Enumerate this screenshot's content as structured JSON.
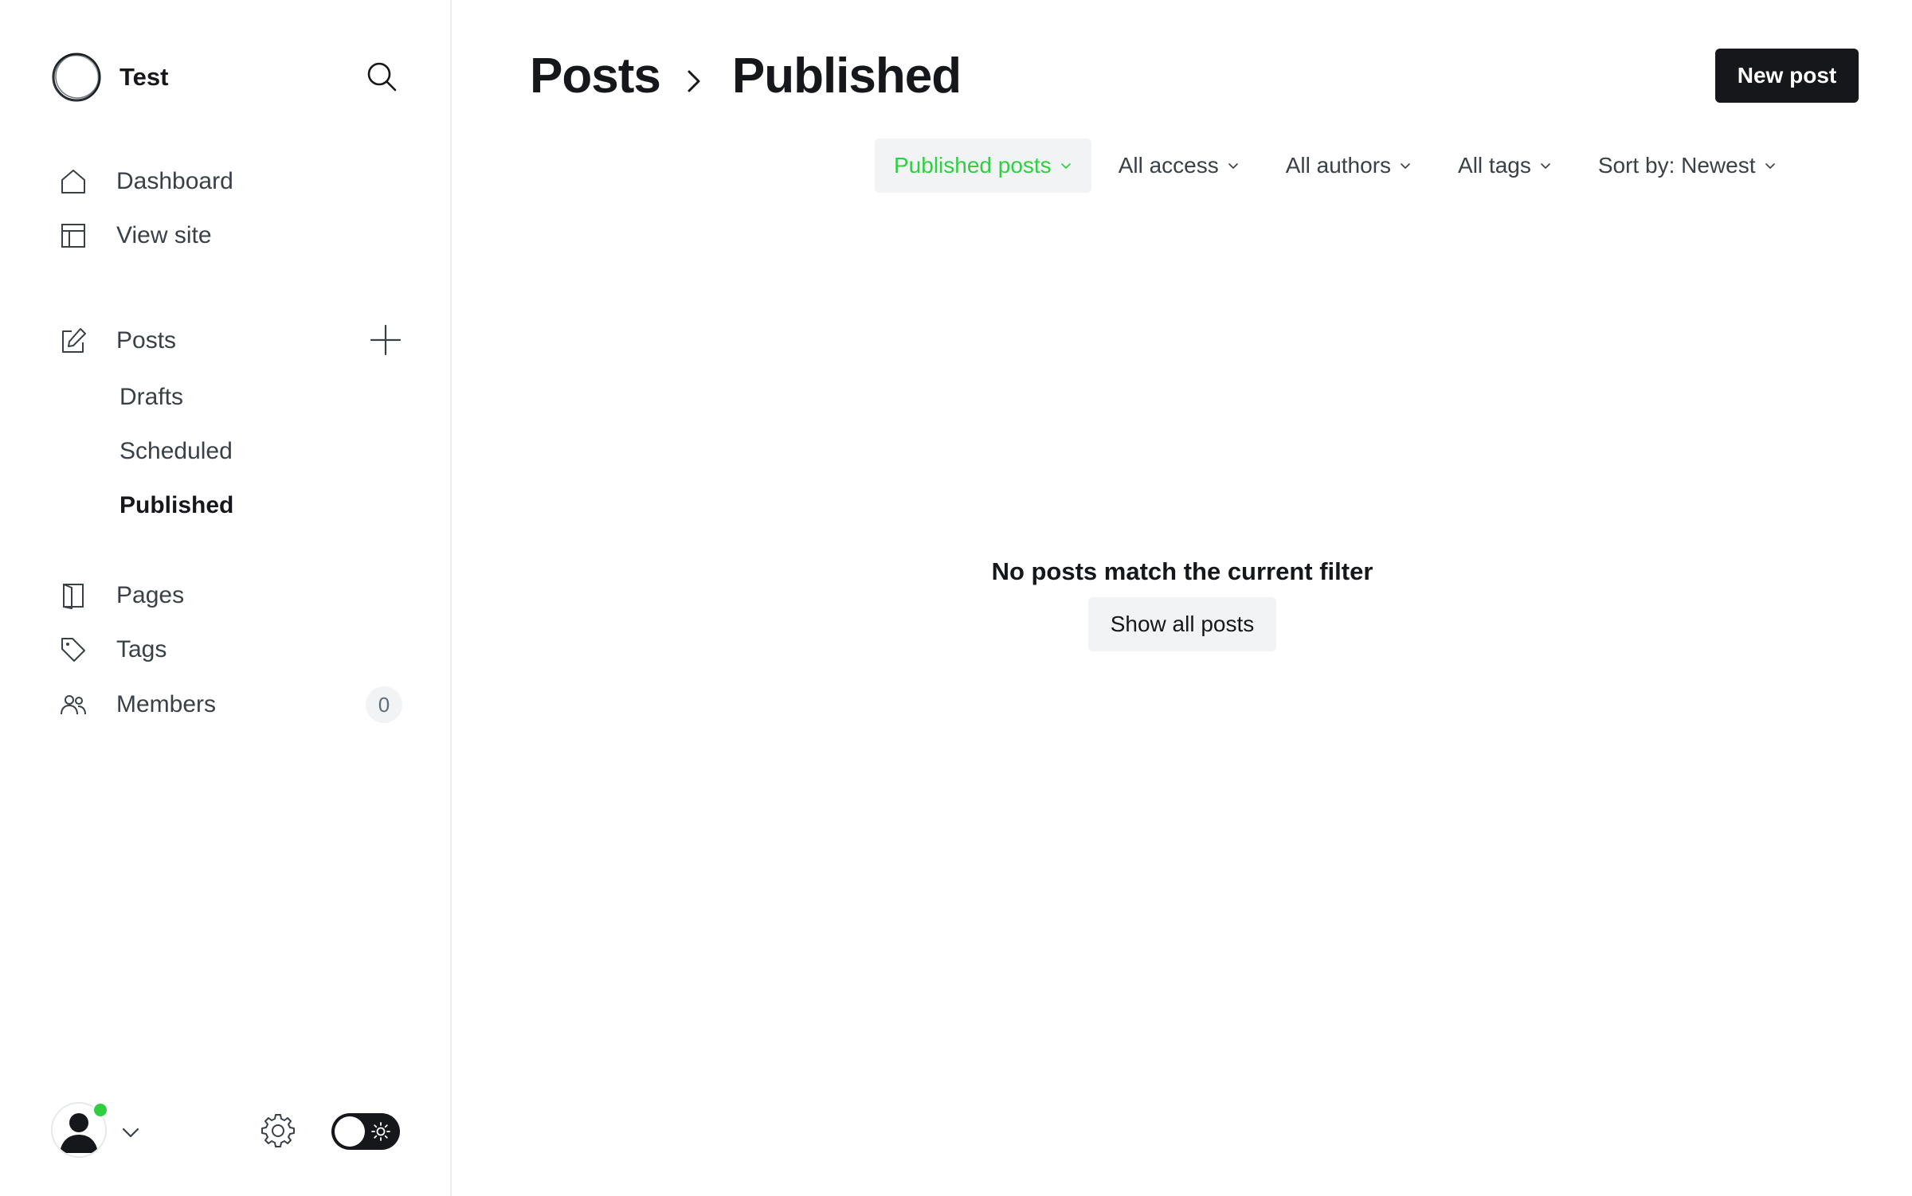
{
  "brand": {
    "name": "Test"
  },
  "sidebar": {
    "nav_top": [
      {
        "label": "Dashboard",
        "icon": "home-icon"
      },
      {
        "label": "View site",
        "icon": "layout-icon"
      }
    ],
    "posts": {
      "label": "Posts",
      "icon": "edit-icon",
      "add_icon": "plus-icon",
      "sub_items": [
        {
          "label": "Drafts",
          "active": false
        },
        {
          "label": "Scheduled",
          "active": false
        },
        {
          "label": "Published",
          "active": true
        }
      ]
    },
    "nav_bottom": [
      {
        "label": "Pages",
        "icon": "pages-icon"
      },
      {
        "label": "Tags",
        "icon": "tag-icon"
      },
      {
        "label": "Members",
        "icon": "members-icon",
        "count": "0"
      }
    ],
    "footer": {
      "online": true,
      "theme": "light"
    }
  },
  "header": {
    "breadcrumb_root": "Posts",
    "breadcrumb_current": "Published",
    "new_post_label": "New post"
  },
  "filters": [
    {
      "label": "Published posts",
      "active": true
    },
    {
      "label": "All access",
      "active": false
    },
    {
      "label": "All authors",
      "active": false
    },
    {
      "label": "All tags",
      "active": false
    },
    {
      "label": "Sort by: Newest",
      "active": false
    }
  ],
  "empty_state": {
    "message": "No posts match the current filter",
    "button_label": "Show all posts"
  },
  "colors": {
    "accent": "#30cf43",
    "primary_button": "#15171a",
    "text": "#15171a",
    "muted_bg": "#f1f3f4"
  }
}
